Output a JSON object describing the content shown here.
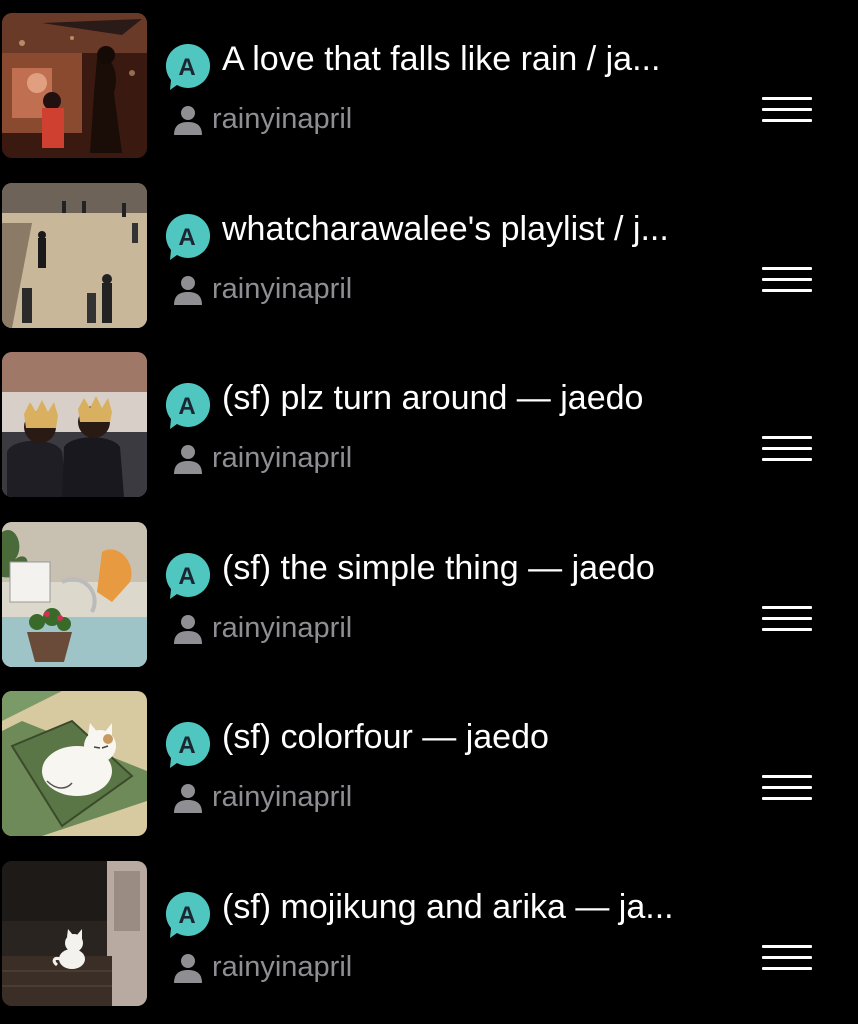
{
  "colors": {
    "background": "#000000",
    "badge_fill": "#4fc7c0",
    "badge_text": "#1b2630",
    "author_text": "#8e8e93",
    "title_text": "#ffffff"
  },
  "icons": {
    "badge": "speech-bubble-a-icon",
    "author": "person-icon",
    "reorder": "hamburger-reorder-icon"
  },
  "playlists": [
    {
      "badge_letter": "A",
      "title": "A love that falls like rain / ja...",
      "author": "rainyinapril"
    },
    {
      "badge_letter": "A",
      "title": "whatcharawalee's playlist / j...",
      "author": "rainyinapril"
    },
    {
      "badge_letter": "A",
      "title": "(sf) plz turn around — jaedo",
      "author": "rainyinapril"
    },
    {
      "badge_letter": "A",
      "title": "(sf) the simple thing — jaedo",
      "author": "rainyinapril"
    },
    {
      "badge_letter": "A",
      "title": "(sf) colorfour — jaedo",
      "author": "rainyinapril"
    },
    {
      "badge_letter": "A",
      "title": "(sf) mojikung and arika — ja...",
      "author": "rainyinapril"
    }
  ]
}
